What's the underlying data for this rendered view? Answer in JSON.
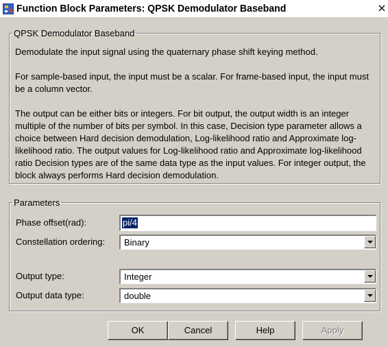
{
  "window": {
    "title": "Function Block Parameters: QPSK Demodulator Baseband",
    "close_glyph": "×"
  },
  "description": {
    "legend": "QPSK Demodulator Baseband",
    "p1": "Demodulate the input signal using the quaternary phase shift keying method.",
    "p2": "For sample-based input, the input must be a scalar. For frame-based input, the input must be a column vector.",
    "p3": "The output can be either bits or integers. For bit output, the output width is an integer multiple of the number of bits per symbol. In this case, Decision type parameter allows a choice between Hard decision demodulation, Log-likelihood ratio and Approximate log-likelihood ratio.  The output values for Log-likelihood ratio and Approximate log-likelihood ratio Decision types are of the same data type as the input values. For integer output, the block always performs Hard decision demodulation."
  },
  "parameters": {
    "legend": "Parameters",
    "phase_offset": {
      "label": "Phase offset(rad):",
      "value": "pi/4"
    },
    "constellation_ordering": {
      "label": "Constellation ordering:",
      "value": "Binary"
    },
    "output_type": {
      "label": "Output type:",
      "value": "Integer"
    },
    "output_data_type": {
      "label": "Output data type:",
      "value": "double"
    }
  },
  "buttons": {
    "ok": "OK",
    "cancel": "Cancel",
    "help": "Help",
    "apply": "Apply"
  },
  "colors": {
    "dialog_bg": "#d4d0c8",
    "selection": "#0a246a"
  }
}
